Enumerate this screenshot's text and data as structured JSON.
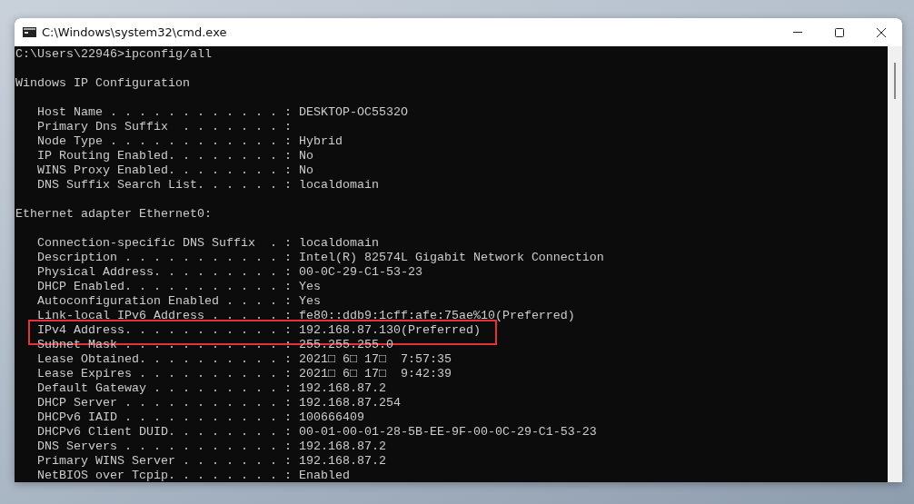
{
  "window": {
    "title": "C:\\Windows\\system32\\cmd.exe"
  },
  "console_lines": [
    {
      "kind": "text",
      "text": "C:\\Users\\22946>ipconfig/all",
      "highlighted": false
    },
    {
      "kind": "blank"
    },
    {
      "kind": "text",
      "text": "Windows IP Configuration",
      "highlighted": false
    },
    {
      "kind": "blank"
    },
    {
      "kind": "entry",
      "text": "Host Name . . . . . . . . . . . . : DESKTOP-OC5532O",
      "highlighted": false
    },
    {
      "kind": "entry",
      "text": "Primary Dns Suffix  . . . . . . . :",
      "highlighted": false
    },
    {
      "kind": "entry",
      "text": "Node Type . . . . . . . . . . . . : Hybrid",
      "highlighted": false
    },
    {
      "kind": "entry",
      "text": "IP Routing Enabled. . . . . . . . : No",
      "highlighted": false
    },
    {
      "kind": "entry",
      "text": "WINS Proxy Enabled. . . . . . . . : No",
      "highlighted": false
    },
    {
      "kind": "entry",
      "text": "DNS Suffix Search List. . . . . . : localdomain",
      "highlighted": false
    },
    {
      "kind": "blank"
    },
    {
      "kind": "text",
      "text": "Ethernet adapter Ethernet0:",
      "highlighted": false
    },
    {
      "kind": "blank"
    },
    {
      "kind": "entry",
      "text": "Connection-specific DNS Suffix  . : localdomain",
      "highlighted": false
    },
    {
      "kind": "entry",
      "text": "Description . . . . . . . . . . . : Intel(R) 82574L Gigabit Network Connection",
      "highlighted": false
    },
    {
      "kind": "entry",
      "text": "Physical Address. . . . . . . . . : 00-0C-29-C1-53-23",
      "highlighted": false
    },
    {
      "kind": "entry",
      "text": "DHCP Enabled. . . . . . . . . . . : Yes",
      "highlighted": false
    },
    {
      "kind": "entry",
      "text": "Autoconfiguration Enabled . . . . : Yes",
      "highlighted": false
    },
    {
      "kind": "entry",
      "text": "Link-local IPv6 Address . . . . . : fe80::ddb9:1cff:afe:75ae%10(Preferred)",
      "highlighted": false
    },
    {
      "kind": "entry",
      "text": "IPv4 Address. . . . . . . . . . . : 192.168.87.130(Preferred)",
      "highlighted": true
    },
    {
      "kind": "entry",
      "text": "Subnet Mask . . . . . . . . . . . : 255.255.255.0",
      "highlighted": false
    },
    {
      "kind": "entry",
      "text": "Lease Obtained. . . . . . . . . . : 2021□ 6□ 17□  7:57:35",
      "highlighted": false
    },
    {
      "kind": "entry",
      "text": "Lease Expires . . . . . . . . . . : 2021□ 6□ 17□  9:42:39",
      "highlighted": false
    },
    {
      "kind": "entry",
      "text": "Default Gateway . . . . . . . . . : 192.168.87.2",
      "highlighted": false
    },
    {
      "kind": "entry",
      "text": "DHCP Server . . . . . . . . . . . : 192.168.87.254",
      "highlighted": false
    },
    {
      "kind": "entry",
      "text": "DHCPv6 IAID . . . . . . . . . . . : 100666409",
      "highlighted": false
    },
    {
      "kind": "entry",
      "text": "DHCPv6 Client DUID. . . . . . . . : 00-01-00-01-28-5B-EE-9F-00-0C-29-C1-53-23",
      "highlighted": false
    },
    {
      "kind": "entry",
      "text": "DNS Servers . . . . . . . . . . . : 192.168.87.2",
      "highlighted": false
    },
    {
      "kind": "entry",
      "text": "Primary WINS Server . . . . . . . : 192.168.87.2",
      "highlighted": false
    },
    {
      "kind": "entry",
      "text": "NetBIOS over Tcpip. . . . . . . . : Enabled",
      "highlighted": false
    }
  ]
}
